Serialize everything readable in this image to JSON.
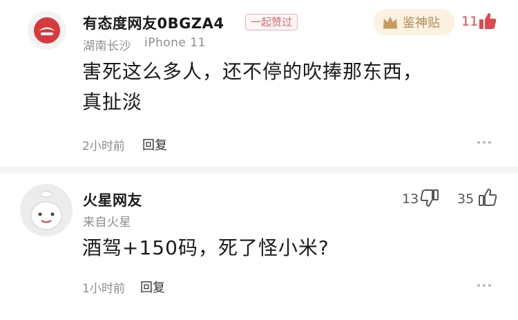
{
  "comments": [
    {
      "user": "有态度网友0BGZA4",
      "tag": "一起赞过",
      "badge": "鉴神贴",
      "location": "湖南长沙",
      "device": "iPhone 11",
      "text_line1": "害死这么多人，还不停的吹捧那东西，",
      "text_line2": "真扯淡",
      "time": "2小时前",
      "reply": "回复",
      "likes": "11"
    },
    {
      "user": "火星网友",
      "source": "来自火星",
      "text": "酒驾+150码，死了怪小米?",
      "time": "1小时前",
      "reply": "回复",
      "dislikes": "13",
      "likes": "35"
    }
  ],
  "colors": {
    "accent_red": "#e0484f",
    "badge_gold": "#b08a56",
    "muted_text": "#8c8c8c"
  },
  "icons": [
    "netease-avatar-icon",
    "crown-icon",
    "thumbs-up-icon",
    "mars-avatar-icon",
    "thumbs-down-icon",
    "more-icon"
  ]
}
